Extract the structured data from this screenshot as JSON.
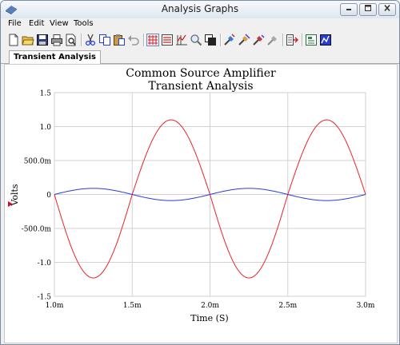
{
  "window": {
    "title": "Analysis Graphs",
    "icon": "app-icon"
  },
  "menu": [
    "File",
    "Edit",
    "View",
    "Tools"
  ],
  "toolbar": {
    "icons": [
      "new-icon",
      "open-icon",
      "save-icon",
      "print-icon",
      "print-preview-icon",
      "cut-icon",
      "copy-icon",
      "paste-icon",
      "undo-icon",
      "grid-icon",
      "legend-icon",
      "cursors-icon",
      "zoom-icon",
      "overlay-icon",
      "select-trace-icon",
      "trace-properties-icon",
      "plot-icon",
      "cursor-properties-icon",
      "export-icon",
      "data-icon",
      "graph-properties-icon"
    ]
  },
  "tab": {
    "label": "Transient Analysis"
  },
  "chart_data": {
    "type": "line",
    "title": "Common Source Amplifier",
    "subtitle": "Transient Analysis",
    "xlabel": "Time (S)",
    "ylabel": "Volts",
    "xlim": [
      0.001,
      0.003
    ],
    "ylim": [
      -1.5,
      1.5
    ],
    "x_ticks": [
      "1.0m",
      "1.5m",
      "2.0m",
      "2.5m",
      "3.0m"
    ],
    "y_ticks": [
      "1.5",
      "1.0",
      "500.0m",
      "0",
      "-500.0m",
      "-1.0",
      "-1.5"
    ],
    "grid": true,
    "series": [
      {
        "color": "#e8242a",
        "x": [
          0.001,
          0.00125,
          0.0015,
          0.00175,
          0.002,
          0.00225,
          0.0025,
          0.00275,
          0.003
        ],
        "y": [
          0,
          -1.23,
          0,
          1.1,
          0,
          -1.23,
          0,
          1.1,
          0
        ]
      },
      {
        "color": "#2a3bd6",
        "x": [
          0.001,
          0.00125,
          0.0015,
          0.00175,
          0.002,
          0.00225,
          0.0025,
          0.00275,
          0.003
        ],
        "y": [
          0,
          0.09,
          0,
          -0.09,
          0,
          0.09,
          0,
          -0.09,
          0
        ]
      }
    ]
  }
}
